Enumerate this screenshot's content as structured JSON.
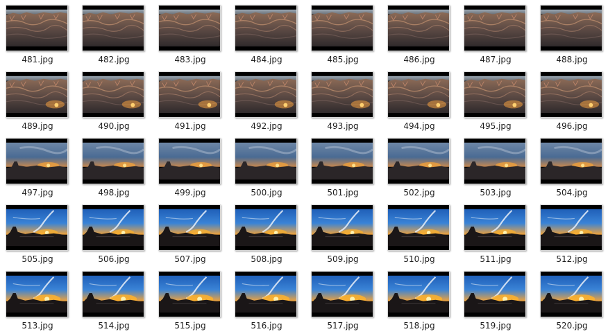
{
  "files": [
    {
      "name": "481.jpg",
      "scene": "canyon"
    },
    {
      "name": "482.jpg",
      "scene": "canyon"
    },
    {
      "name": "483.jpg",
      "scene": "canyon"
    },
    {
      "name": "484.jpg",
      "scene": "canyon"
    },
    {
      "name": "485.jpg",
      "scene": "canyon"
    },
    {
      "name": "486.jpg",
      "scene": "canyon"
    },
    {
      "name": "487.jpg",
      "scene": "canyon"
    },
    {
      "name": "488.jpg",
      "scene": "canyon"
    },
    {
      "name": "489.jpg",
      "scene": "canyon-glow"
    },
    {
      "name": "490.jpg",
      "scene": "canyon-glow"
    },
    {
      "name": "491.jpg",
      "scene": "canyon-glow"
    },
    {
      "name": "492.jpg",
      "scene": "canyon-glow"
    },
    {
      "name": "493.jpg",
      "scene": "canyon-glow"
    },
    {
      "name": "494.jpg",
      "scene": "canyon-glow"
    },
    {
      "name": "495.jpg",
      "scene": "canyon-glow"
    },
    {
      "name": "496.jpg",
      "scene": "canyon-glow"
    },
    {
      "name": "497.jpg",
      "scene": "dusk"
    },
    {
      "name": "498.jpg",
      "scene": "dusk"
    },
    {
      "name": "499.jpg",
      "scene": "dusk"
    },
    {
      "name": "500.jpg",
      "scene": "dusk"
    },
    {
      "name": "501.jpg",
      "scene": "dusk"
    },
    {
      "name": "502.jpg",
      "scene": "dusk"
    },
    {
      "name": "503.jpg",
      "scene": "dusk"
    },
    {
      "name": "504.jpg",
      "scene": "dusk"
    },
    {
      "name": "505.jpg",
      "scene": "sunset"
    },
    {
      "name": "506.jpg",
      "scene": "sunset"
    },
    {
      "name": "507.jpg",
      "scene": "sunset"
    },
    {
      "name": "508.jpg",
      "scene": "sunset"
    },
    {
      "name": "509.jpg",
      "scene": "sunset"
    },
    {
      "name": "510.jpg",
      "scene": "sunset"
    },
    {
      "name": "511.jpg",
      "scene": "sunset"
    },
    {
      "name": "512.jpg",
      "scene": "sunset"
    },
    {
      "name": "513.jpg",
      "scene": "sunset-bright"
    },
    {
      "name": "514.jpg",
      "scene": "sunset-bright"
    },
    {
      "name": "515.jpg",
      "scene": "sunset-bright"
    },
    {
      "name": "516.jpg",
      "scene": "sunset-bright"
    },
    {
      "name": "517.jpg",
      "scene": "sunset-bright"
    },
    {
      "name": "518.jpg",
      "scene": "sunset-bright"
    },
    {
      "name": "519.jpg",
      "scene": "sunset-bright"
    },
    {
      "name": "520.jpg",
      "scene": "sunset-bright"
    }
  ],
  "colors": {
    "label_text": "#1e1e1e",
    "background": "#ffffff",
    "sky_day": "#2f6fc4",
    "sky_dusk": "#4a6b93",
    "sun": "#ffb22a",
    "canyon_rock": "#7a5a48"
  }
}
